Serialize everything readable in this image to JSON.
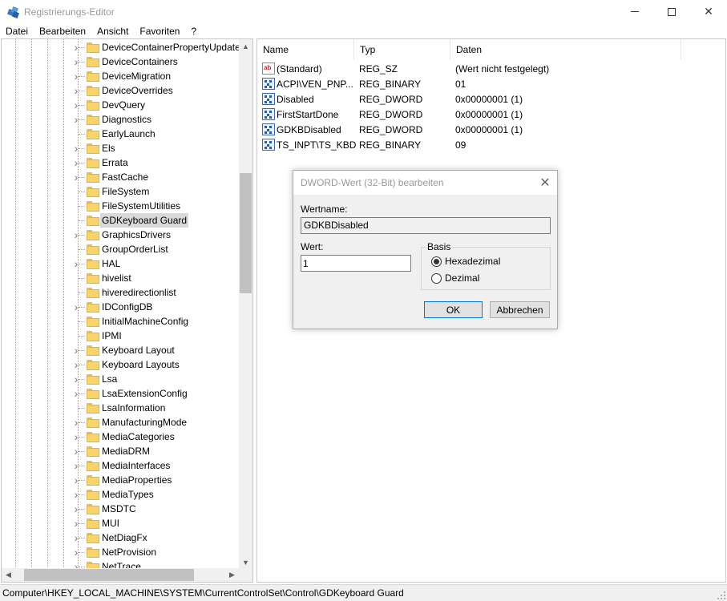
{
  "window": {
    "title": "Registrierungs-Editor",
    "icon": "registry-editor-icon"
  },
  "menu": [
    "Datei",
    "Bearbeiten",
    "Ansicht",
    "Favoriten",
    "?"
  ],
  "tree": {
    "selected": "GDKeyboard Guard",
    "items": [
      {
        "label": "DeviceContainerPropertyUpdate",
        "expandable": true
      },
      {
        "label": "DeviceContainers",
        "expandable": true
      },
      {
        "label": "DeviceMigration",
        "expandable": true
      },
      {
        "label": "DeviceOverrides",
        "expandable": true
      },
      {
        "label": "DevQuery",
        "expandable": true
      },
      {
        "label": "Diagnostics",
        "expandable": true
      },
      {
        "label": "EarlyLaunch",
        "expandable": false
      },
      {
        "label": "Els",
        "expandable": true
      },
      {
        "label": "Errata",
        "expandable": true
      },
      {
        "label": "FastCache",
        "expandable": true
      },
      {
        "label": "FileSystem",
        "expandable": false
      },
      {
        "label": "FileSystemUtilities",
        "expandable": false
      },
      {
        "label": "GDKeyboard Guard",
        "expandable": false
      },
      {
        "label": "GraphicsDrivers",
        "expandable": true
      },
      {
        "label": "GroupOrderList",
        "expandable": false
      },
      {
        "label": "HAL",
        "expandable": true
      },
      {
        "label": "hivelist",
        "expandable": false
      },
      {
        "label": "hiveredirectionlist",
        "expandable": false
      },
      {
        "label": "IDConfigDB",
        "expandable": true
      },
      {
        "label": "InitialMachineConfig",
        "expandable": false
      },
      {
        "label": "IPMI",
        "expandable": false
      },
      {
        "label": "Keyboard Layout",
        "expandable": true
      },
      {
        "label": "Keyboard Layouts",
        "expandable": true
      },
      {
        "label": "Lsa",
        "expandable": true
      },
      {
        "label": "LsaExtensionConfig",
        "expandable": true
      },
      {
        "label": "LsaInformation",
        "expandable": false
      },
      {
        "label": "ManufacturingMode",
        "expandable": true
      },
      {
        "label": "MediaCategories",
        "expandable": true
      },
      {
        "label": "MediaDRM",
        "expandable": true
      },
      {
        "label": "MediaInterfaces",
        "expandable": true
      },
      {
        "label": "MediaProperties",
        "expandable": true
      },
      {
        "label": "MediaTypes",
        "expandable": true
      },
      {
        "label": "MSDTC",
        "expandable": true
      },
      {
        "label": "MUI",
        "expandable": true
      },
      {
        "label": "NetDiagFx",
        "expandable": true
      },
      {
        "label": "NetProvision",
        "expandable": true
      },
      {
        "label": "NetTrace",
        "expandable": true
      }
    ]
  },
  "values": {
    "columns": [
      "Name",
      "Typ",
      "Daten"
    ],
    "rows": [
      {
        "name": "(Standard)",
        "type": "REG_SZ",
        "data": "(Wert nicht festgelegt)",
        "icon": "string-value-icon"
      },
      {
        "name": "ACPI\\VEN_PNP...",
        "type": "REG_BINARY",
        "data": "01",
        "icon": "binary-value-icon"
      },
      {
        "name": "Disabled",
        "type": "REG_DWORD",
        "data": "0x00000001 (1)",
        "icon": "binary-value-icon"
      },
      {
        "name": "FirstStartDone",
        "type": "REG_DWORD",
        "data": "0x00000001 (1)",
        "icon": "binary-value-icon"
      },
      {
        "name": "GDKBDisabled",
        "type": "REG_DWORD",
        "data": "0x00000001 (1)",
        "icon": "binary-value-icon"
      },
      {
        "name": "TS_INPT\\TS_KBD",
        "type": "REG_BINARY",
        "data": "09",
        "icon": "binary-value-icon"
      }
    ]
  },
  "dialog": {
    "title": "DWORD-Wert (32-Bit) bearbeiten",
    "name_label": "Wertname:",
    "name_value": "GDKBDisabled",
    "value_label": "Wert:",
    "value": "1",
    "base_label": "Basis",
    "hex_label": "Hexadezimal",
    "dec_label": "Dezimal",
    "selected_base": "Hexadezimal",
    "ok_label": "OK",
    "cancel_label": "Abbrechen",
    "close_glyph": "✕"
  },
  "statusbar": {
    "path": "Computer\\HKEY_LOCAL_MACHINE\\SYSTEM\\CurrentControlSet\\Control\\GDKeyboard Guard"
  }
}
